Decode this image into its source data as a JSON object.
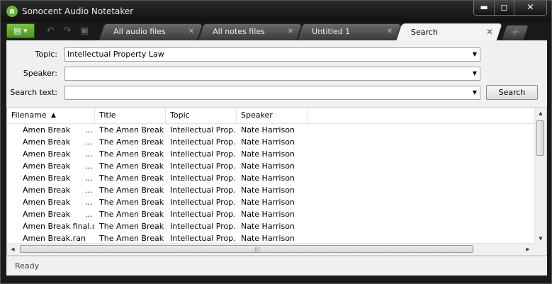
{
  "window": {
    "title": "Sonocent Audio Notetaker",
    "logo": "a"
  },
  "window_controls": {
    "minimize": "▬",
    "maximize": "◻",
    "close": "✕"
  },
  "toolbar": {
    "view_glyph": "▤ ▾",
    "undo": "↶",
    "redo": "↷",
    "save": "▣"
  },
  "tabs": [
    {
      "label": "All audio files",
      "close": "✕"
    },
    {
      "label": "All notes files",
      "close": "✕"
    },
    {
      "label": "Untitled 1",
      "close": "✕"
    },
    {
      "label": "Search",
      "close": "✕"
    }
  ],
  "add_tab": "+",
  "form": {
    "topic_label": "Topic:",
    "topic_value": "Intellectual Property Law",
    "speaker_label": "Speaker:",
    "speaker_value": "",
    "search_label": "Search text:",
    "search_value": "",
    "search_button": "Search",
    "arrow": "▼"
  },
  "table": {
    "columns": [
      "Filename",
      "Title",
      "Topic",
      "Speaker"
    ],
    "sort_indicator": "▲",
    "rows": [
      [
        "Amen Break",
        "...",
        "The Amen Break",
        "Intellectual Prop...",
        "Nate Harrison"
      ],
      [
        "Amen Break",
        "...",
        "The Amen Break",
        "Intellectual Prop...",
        "Nate Harrison"
      ],
      [
        "Amen Break",
        "...",
        "The Amen Break",
        "Intellectual Prop...",
        "Nate Harrison"
      ],
      [
        "Amen Break",
        "...",
        "The Amen Break",
        "Intellectual Prop...",
        "Nate Harrison"
      ],
      [
        "Amen Break",
        "...",
        "The Amen Break",
        "Intellectual Prop...",
        "Nate Harrison"
      ],
      [
        "Amen Break",
        "...",
        "The Amen Break",
        "Intellectual Prop...",
        "Nate Harrison"
      ],
      [
        "Amen Break",
        "...",
        "The Amen Break",
        "Intellectual Prop...",
        "Nate Harrison"
      ],
      [
        "Amen Break",
        "...",
        "The Amen Break",
        "Intellectual Prop...",
        "Nate Harrison"
      ],
      [
        "Amen Break final.ran",
        "",
        "The Amen Break",
        "Intellectual Prop...",
        "Nate Harrison"
      ],
      [
        "Amen Break.ran",
        "",
        "The Amen Break",
        "Intellectual Prop...",
        "Nate Harrison"
      ]
    ]
  },
  "scroll": {
    "up": "▲",
    "down": "▼",
    "left": "◀",
    "right": "▶",
    "grip_v": "≡",
    "grip_h": "|||"
  },
  "status": {
    "text": "Ready"
  }
}
